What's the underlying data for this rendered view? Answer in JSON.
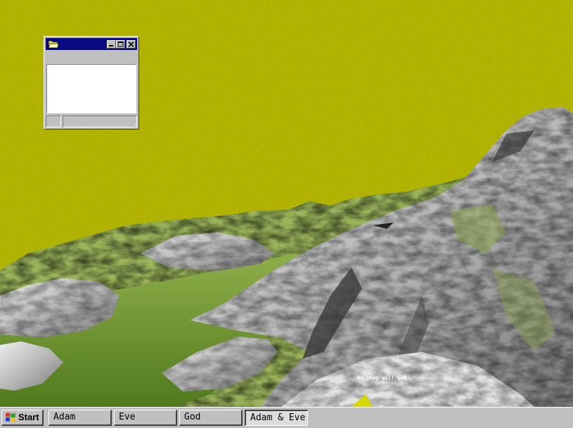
{
  "desktop": {
    "background_color": "#d6d800",
    "caption": "As they will God"
  },
  "window": {
    "title": "",
    "icon": "folder-icon",
    "buttons": [
      "minimize-icon",
      "maximize-icon",
      "close-icon"
    ]
  },
  "taskbar": {
    "start_label": "Start",
    "tasks": [
      {
        "label": "Adam",
        "active": false
      },
      {
        "label": "Eve",
        "active": false
      },
      {
        "label": "God",
        "active": false
      },
      {
        "label": "Adam & Eve",
        "active": true
      }
    ]
  }
}
